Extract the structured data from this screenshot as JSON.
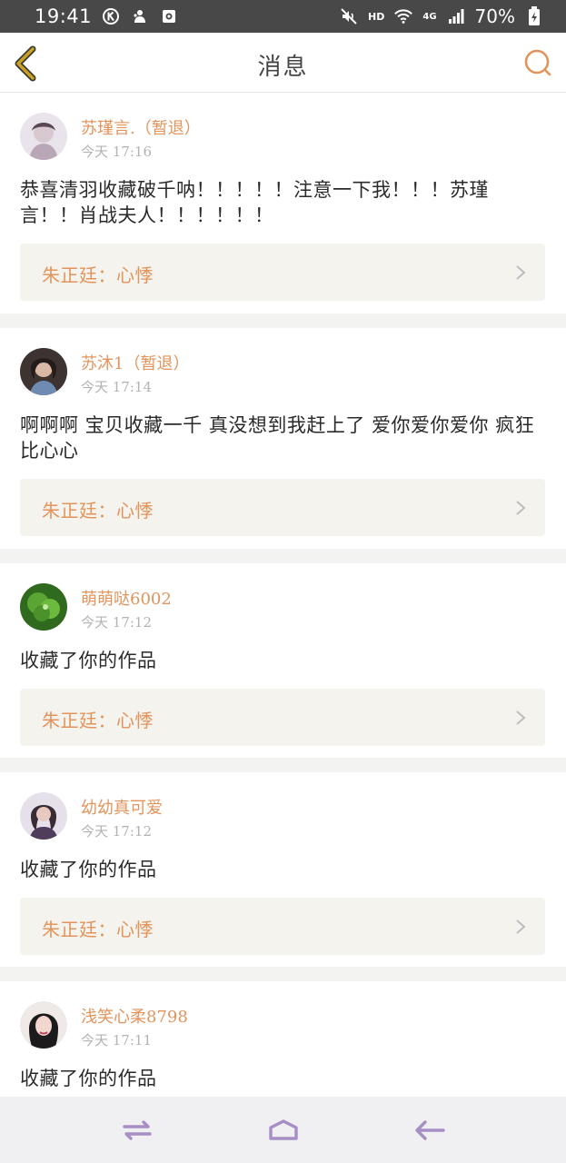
{
  "status_bar": {
    "time": "19:41",
    "network_label": "HD",
    "signal_label": "4G",
    "battery": "70%",
    "icons": [
      "k-circle-icon",
      "pet-icon",
      "app-icon",
      "mute-icon",
      "wifi-icon",
      "signal-icon",
      "battery-charging-icon"
    ]
  },
  "header": {
    "title": "消息",
    "back_icon": "chevron-left-icon",
    "search_icon": "search-icon"
  },
  "colors": {
    "accent": "#e3945c",
    "back_arrow": "#c9a125",
    "ref_background": "#f4f3ee",
    "status_bar": "#484848",
    "nav_bar": "#f0eff1",
    "nav_icons": "#a58fc4"
  },
  "messages": [
    {
      "user": "苏瑾言.（暂退）",
      "time": "今天 17:16",
      "text": "恭喜清羽收藏破千呐！！！！！注意一下我！！！苏瑾言！！肖战夫人！！！！！！",
      "ref": "朱正廷：心悸"
    },
    {
      "user": "苏沐1（暂退）",
      "time": "今天 17:14",
      "text": "啊啊啊 宝贝收藏一千 真没想到我赶上了 爱你爱你爱你 疯狂比心心",
      "ref": "朱正廷：心悸"
    },
    {
      "user": "萌萌哒6002",
      "time": "今天 17:12",
      "text": "收藏了你的作品",
      "ref": "朱正廷：心悸"
    },
    {
      "user": "幼幼真可爱",
      "time": "今天 17:12",
      "text": "收藏了你的作品",
      "ref": "朱正廷：心悸"
    },
    {
      "user": "浅笑心柔8798",
      "time": "今天 17:11",
      "text": "收藏了你的作品"
    }
  ],
  "nav_bar": {
    "icons": [
      "recent-apps-icon",
      "home-icon",
      "back-icon"
    ]
  }
}
